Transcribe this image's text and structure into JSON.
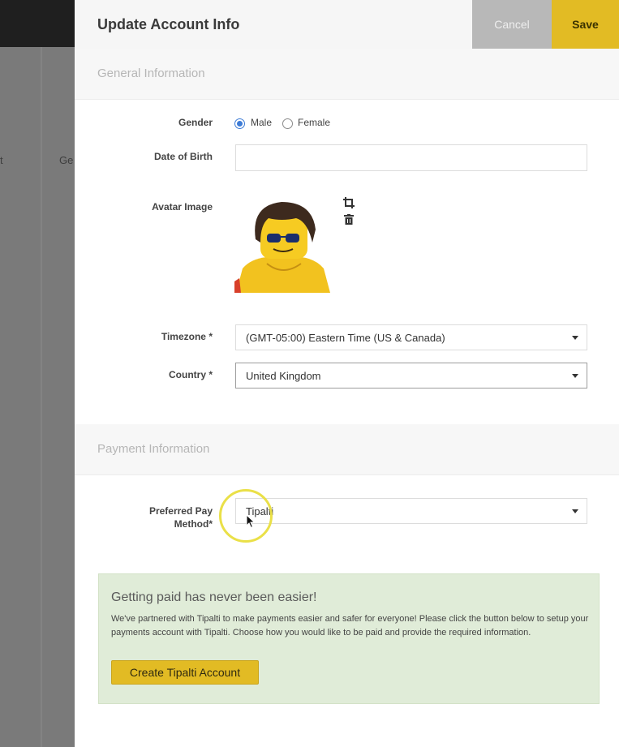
{
  "background": {
    "partial_text_1": "t",
    "partial_text_2": "Ge"
  },
  "panel": {
    "title": "Update Account Info",
    "cancel_label": "Cancel",
    "save_label": "Save"
  },
  "general": {
    "section_title": "General Information",
    "gender_label": "Gender",
    "gender_options": [
      "Male",
      "Female"
    ],
    "gender_selected": "Male",
    "dob_label": "Date of Birth",
    "dob_value": "",
    "avatar_label": "Avatar Image",
    "timezone_label": "Timezone *",
    "timezone_value": "(GMT-05:00) Eastern Time (US & Canada)",
    "country_label": "Country *",
    "country_value": "United Kingdom"
  },
  "payment": {
    "section_title": "Payment Information",
    "pay_method_label_line1": "Preferred Pay",
    "pay_method_label_line2": "Method*",
    "pay_method_value": "Tipalti"
  },
  "promo": {
    "title": "Getting paid has never been easier!",
    "body": "We've partnered with Tipalti to make payments easier and safer for everyone! Please click the button below to setup your payments account with Tipalti. Choose how you would like to be paid and provide the required information.",
    "button_label": "Create Tipalti Account"
  },
  "colors": {
    "accent": "#e2bb24",
    "radio": "#3d7bd6",
    "promo_bg": "#e0ecd8"
  },
  "icons": [
    "crop-icon",
    "trash-icon",
    "cursor-icon"
  ]
}
